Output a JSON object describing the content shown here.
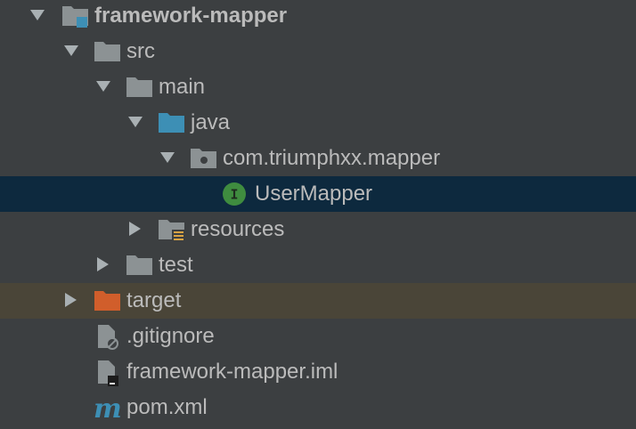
{
  "colors": {
    "background": "#3c3f41",
    "selected_row": "#0d293e",
    "excluded_row": "#4a4538",
    "text": "#bbbbbb",
    "folder": "#8c9294",
    "source_folder": "#3d8fb5",
    "excluded_folder": "#d15e2b",
    "interface_badge": "#3f8c3f"
  },
  "tree": {
    "root": {
      "label": "framework-mapper",
      "icon": "module-folder-icon",
      "expanded": true
    },
    "src": {
      "label": "src",
      "icon": "folder-icon",
      "expanded": true
    },
    "main": {
      "label": "main",
      "icon": "folder-icon",
      "expanded": true
    },
    "java": {
      "label": "java",
      "icon": "source-folder-icon",
      "expanded": true
    },
    "package": {
      "label": "com.triumphxx.mapper",
      "icon": "package-icon",
      "expanded": true
    },
    "usermapper": {
      "label": "UserMapper",
      "icon": "interface-icon",
      "badge": "I",
      "selected": true
    },
    "resources": {
      "label": "resources",
      "icon": "resources-folder-icon",
      "expanded": false
    },
    "test": {
      "label": "test",
      "icon": "folder-icon",
      "expanded": false
    },
    "target": {
      "label": "target",
      "icon": "excluded-folder-icon",
      "expanded": false
    },
    "gitignore": {
      "label": ".gitignore",
      "icon": "ignored-file-icon"
    },
    "iml": {
      "label": "framework-mapper.iml",
      "icon": "module-file-icon"
    },
    "pom": {
      "label": "pom.xml",
      "icon": "maven-icon",
      "glyph": "m"
    }
  }
}
